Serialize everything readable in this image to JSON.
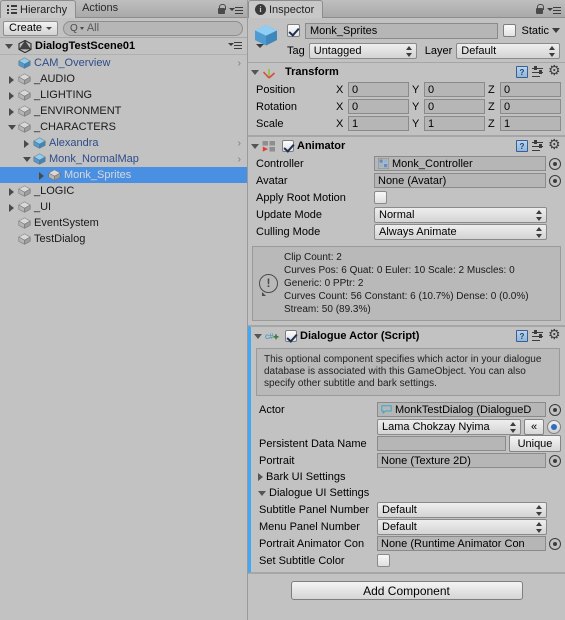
{
  "hierarchy": {
    "tabs": [
      {
        "label": "Hierarchy",
        "icon": "hierarchy-icon",
        "active": true
      },
      {
        "label": "Actions",
        "icon": "",
        "active": false
      }
    ],
    "lock_icon": "lock-icon",
    "menu_icon": "hamburger-menu-icon",
    "toolbar": {
      "create_label": "Create",
      "search_prefix": "Q",
      "search_value": "All",
      "search_placeholder": "All"
    },
    "scene": {
      "name": "DialogTestScene01",
      "expanded": true,
      "icon": "unity-scene-icon"
    },
    "items": [
      {
        "label": "CAM_Overview",
        "indent": 1,
        "expandable": false,
        "expanded": false,
        "prefab": true,
        "selected": false,
        "chevron": true
      },
      {
        "label": "_AUDIO",
        "indent": 1,
        "expandable": true,
        "expanded": false,
        "prefab": false,
        "selected": false,
        "chevron": false
      },
      {
        "label": "_LIGHTING",
        "indent": 1,
        "expandable": true,
        "expanded": false,
        "prefab": false,
        "selected": false,
        "chevron": false
      },
      {
        "label": "_ENVIRONMENT",
        "indent": 1,
        "expandable": true,
        "expanded": false,
        "prefab": false,
        "selected": false,
        "chevron": false
      },
      {
        "label": "_CHARACTERS",
        "indent": 1,
        "expandable": true,
        "expanded": true,
        "prefab": false,
        "selected": false,
        "chevron": false
      },
      {
        "label": "Alexandra",
        "indent": 2,
        "expandable": true,
        "expanded": false,
        "prefab": true,
        "selected": false,
        "chevron": true
      },
      {
        "label": "Monk_NormalMap",
        "indent": 2,
        "expandable": true,
        "expanded": true,
        "prefab": true,
        "selected": false,
        "chevron": true
      },
      {
        "label": "Monk_Sprites",
        "indent": 3,
        "expandable": true,
        "expanded": false,
        "prefab": false,
        "selected": true,
        "chevron": false
      },
      {
        "label": "_LOGIC",
        "indent": 1,
        "expandable": true,
        "expanded": false,
        "prefab": false,
        "selected": false,
        "chevron": false
      },
      {
        "label": "_UI",
        "indent": 1,
        "expandable": true,
        "expanded": false,
        "prefab": false,
        "selected": false,
        "chevron": false
      },
      {
        "label": "EventSystem",
        "indent": 1,
        "expandable": false,
        "expanded": false,
        "prefab": false,
        "selected": false,
        "chevron": false
      },
      {
        "label": "TestDialog",
        "indent": 1,
        "expandable": false,
        "expanded": false,
        "prefab": false,
        "selected": false,
        "chevron": false
      }
    ]
  },
  "inspector": {
    "tab_label": "Inspector",
    "tab_icon": "info-icon",
    "lock_icon": "lock-icon",
    "menu_icon": "hamburger-menu-icon",
    "gameobject": {
      "icon": "gameobject-cube-icon",
      "enabled": true,
      "name": "Monk_Sprites",
      "static_label": "Static",
      "static_checked": false,
      "tag_label": "Tag",
      "tag_value": "Untagged",
      "layer_label": "Layer",
      "layer_value": "Default"
    },
    "components": [
      {
        "id": "transform",
        "title": "Transform",
        "icon": "transform-axis-icon",
        "expanded": true,
        "has_checkbox": false,
        "highlight": false,
        "rows": [
          {
            "label": "Position",
            "x": "0",
            "y": "0",
            "z": "0"
          },
          {
            "label": "Rotation",
            "x": "0",
            "y": "0",
            "z": "0"
          },
          {
            "label": "Scale",
            "x": "1",
            "y": "1",
            "z": "1"
          }
        ],
        "axis_labels": [
          "X",
          "Y",
          "Z"
        ]
      },
      {
        "id": "animator",
        "title": "Animator",
        "icon": "animator-icon",
        "expanded": true,
        "has_checkbox": true,
        "checked": true,
        "highlight": false,
        "fields": {
          "controller_label": "Controller",
          "controller_value": "Monk_Controller",
          "avatar_label": "Avatar",
          "avatar_value": "None (Avatar)",
          "apply_root_motion_label": "Apply Root Motion",
          "apply_root_motion_checked": false,
          "update_mode_label": "Update Mode",
          "update_mode_value": "Normal",
          "culling_mode_label": "Culling Mode",
          "culling_mode_value": "Always Animate"
        },
        "info_icon": "warning-circle-icon",
        "info_lines": [
          "Clip Count: 2",
          "Curves Pos: 6 Quat: 0 Euler: 10 Scale: 2 Muscles: 0",
          "Generic: 0 PPtr: 2",
          "Curves Count: 56 Constant: 6 (10.7%) Dense: 0 (0.0%)",
          "Stream: 50 (89.3%)"
        ]
      },
      {
        "id": "dialogue-actor",
        "title": "Dialogue Actor (Script)",
        "icon": "cs-script-icon",
        "expanded": true,
        "has_checkbox": true,
        "checked": true,
        "highlight": true,
        "help_icon": "warning-circle-icon",
        "help_text": "This optional component specifies which actor in your dialogue database is associated with this GameObject. You can also specify other subtitle and bark settings.",
        "fields": {
          "actor_label": "Actor",
          "actor_value": "MonkTestDialog (DialogueD",
          "actor_icon": "dialogue-database-icon",
          "actor_dropdown_value": "Lama Chokzay Nyima",
          "actor_small_button": "«",
          "persistent_label": "Persistent Data Name",
          "persistent_value": "",
          "unique_button": "Unique",
          "portrait_label": "Portrait",
          "portrait_value": "None (Texture 2D)"
        },
        "foldouts": [
          {
            "label": "Bark UI Settings",
            "expanded": false
          },
          {
            "label": "Dialogue UI Settings",
            "expanded": true
          }
        ],
        "dialogue_ui": [
          {
            "label": "Subtitle Panel Number",
            "value": "Default",
            "type": "dropdown"
          },
          {
            "label": "Menu Panel Number",
            "value": "Default",
            "type": "dropdown"
          },
          {
            "label": "Portrait Animator Con",
            "value": "None (Runtime Animator Con",
            "type": "object"
          },
          {
            "label": "Set Subtitle Color",
            "value": "",
            "type": "checkbox",
            "checked": false
          }
        ]
      }
    ],
    "add_component_label": "Add Component"
  },
  "colors": {
    "panel_bg": "#c2c2c2",
    "selection_blue": "#4a90e2",
    "highlight_stripe": "#3fa9f5",
    "field_bg": "#b6b6b6",
    "prefab_blue_text": "#2d4c8a"
  }
}
